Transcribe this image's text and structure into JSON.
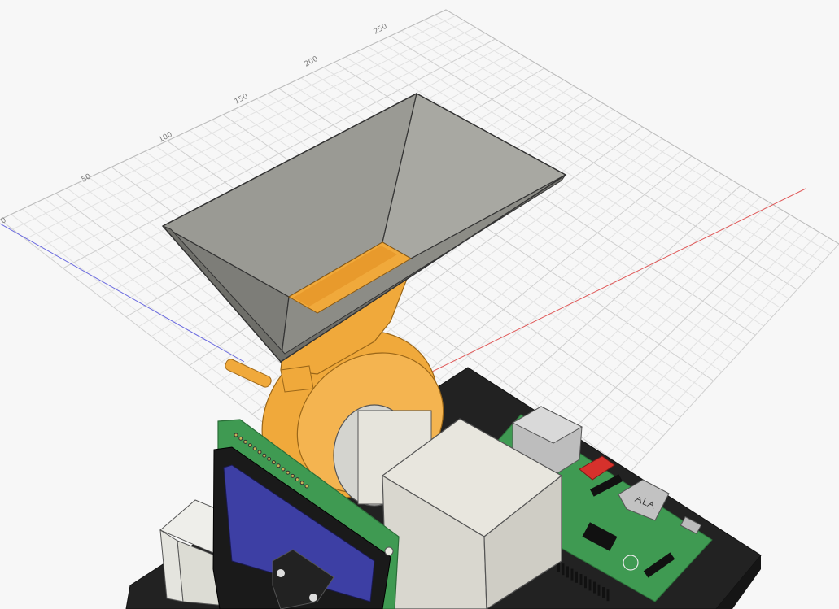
{
  "viewport": {
    "background": "#f7f7f7",
    "grid_color": "#d9d9d9",
    "axis_x_color": "#e05a5a",
    "axis_y_color": "#6a6ae0"
  },
  "ruler": {
    "labels": [
      "0",
      "50",
      "100",
      "150",
      "200",
      "250"
    ]
  },
  "model": {
    "hopper_color": "#8c8c86",
    "body_color": "#f0a93b",
    "motor_color": "#e6e4dc",
    "pcb_color": "#3f9a52",
    "lcd_color": "#3d3fa4",
    "base_color": "#1f1f1f"
  }
}
